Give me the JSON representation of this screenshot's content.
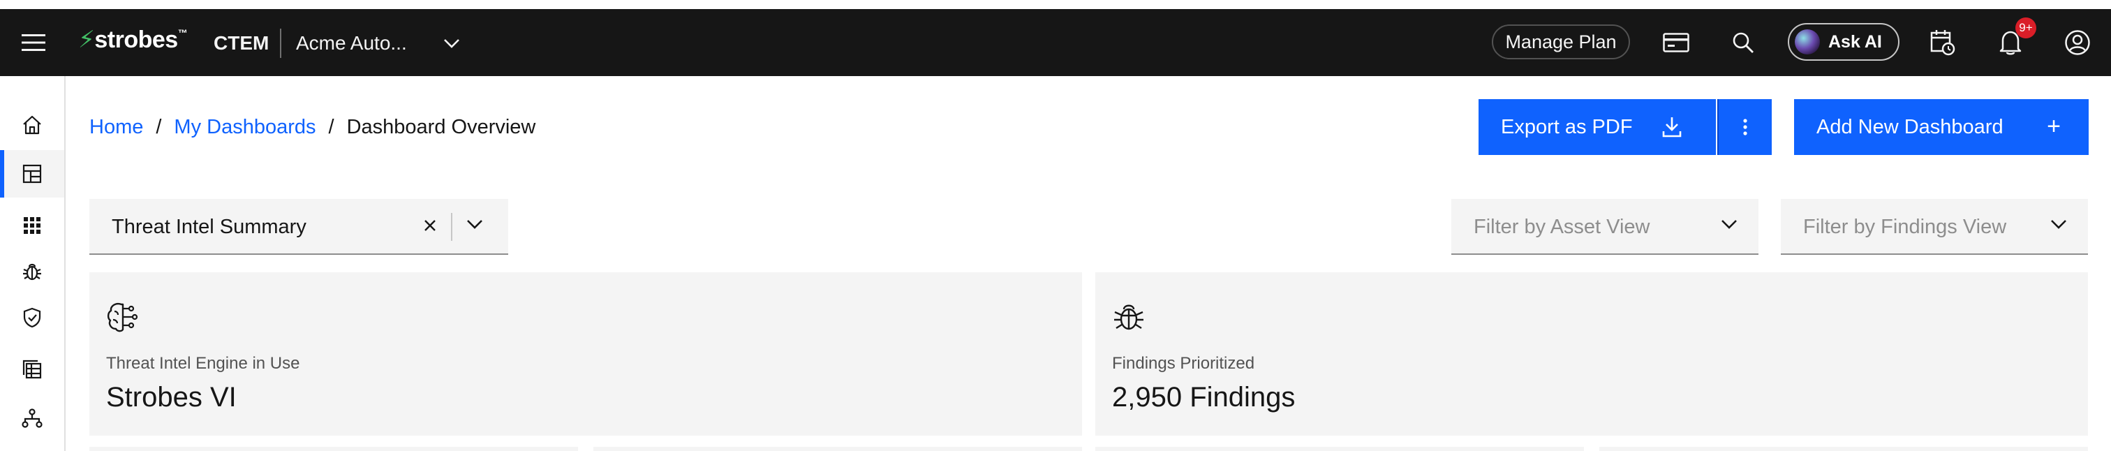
{
  "topbar": {
    "logo_text": "strobes",
    "logo_bolt": "⚡",
    "logo_tm": "™",
    "product": "CTEM",
    "org_name": "Acme Auto...",
    "manage_plan": "Manage Plan",
    "ask_ai": "Ask AI",
    "notification_count": "9+"
  },
  "breadcrumb": {
    "home": "Home",
    "sep1": "/",
    "dashboards": "My Dashboards",
    "sep2": "/",
    "current": "Dashboard Overview"
  },
  "actions": {
    "export": "Export as PDF",
    "add_dashboard": "Add New Dashboard",
    "add_plus": "+"
  },
  "dashboard_select": {
    "value": "Threat Intel Summary"
  },
  "filters": {
    "asset_view_placeholder": "Filter by Asset View",
    "findings_view_placeholder": "Filter by Findings View"
  },
  "cards": [
    {
      "label": "Threat Intel Engine in Use",
      "value": "Strobes VI",
      "icon": "brain-circuit-icon"
    },
    {
      "label": "Findings Prioritized",
      "value": "2,950 Findings",
      "icon": "bug-icon"
    }
  ],
  "colors": {
    "topbar_bg": "#161616",
    "primary": "#0f62fe",
    "field_bg": "#f4f4f4",
    "badge": "#da1e28",
    "logo_accent": "#42be65"
  }
}
